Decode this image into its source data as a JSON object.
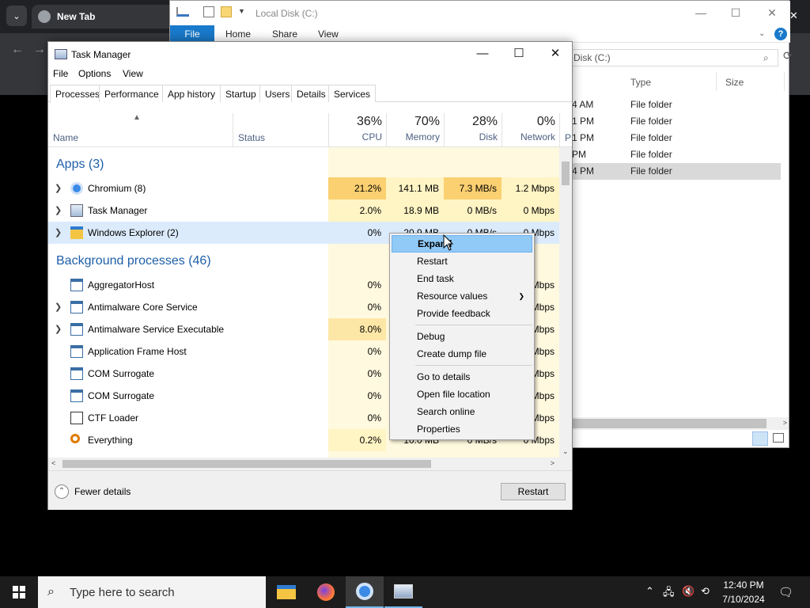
{
  "chrome": {
    "tab_title": "New Tab",
    "close_symbol": "✕"
  },
  "explorer": {
    "title": "Local Disk (C:)",
    "ribbon": [
      "File",
      "Home",
      "Share",
      "View"
    ],
    "address": "Disk (C:)",
    "columns": {
      "type": "Type",
      "size": "Size"
    },
    "rows": [
      {
        "date": "4 AM",
        "type": "File folder",
        "selected": false
      },
      {
        "date": "1 PM",
        "type": "File folder",
        "selected": false
      },
      {
        "date": "1 PM",
        "type": "File folder",
        "selected": false
      },
      {
        "date": "PM",
        "type": "File folder",
        "selected": false
      },
      {
        "date": "4 PM",
        "type": "File folder",
        "selected": true
      }
    ]
  },
  "taskmanager": {
    "title": "Task Manager",
    "menu": [
      "File",
      "Options",
      "View"
    ],
    "tabs": [
      "Processes",
      "Performance",
      "App history",
      "Startup",
      "Users",
      "Details",
      "Services"
    ],
    "active_tab": "Processes",
    "header": {
      "name": "Name",
      "status": "Status",
      "cpu_pct": "36%",
      "cpu": "CPU",
      "mem_pct": "70%",
      "mem": "Memory",
      "disk_pct": "28%",
      "disk": "Disk",
      "net_pct": "0%",
      "net": "Network",
      "power": "P"
    },
    "apps_group": "Apps (3)",
    "apps": [
      {
        "name": "Chromium (8)",
        "cpu": "21.2%",
        "mem": "141.1 MB",
        "disk": "7.3 MB/s",
        "net": "1.2 Mbps",
        "icon": "chromium-icon"
      },
      {
        "name": "Task Manager",
        "cpu": "2.0%",
        "mem": "18.9 MB",
        "disk": "0 MB/s",
        "net": "0 Mbps",
        "icon": "task-manager-icon"
      },
      {
        "name": "Windows Explorer (2)",
        "cpu": "0%",
        "mem": "20.9 MB",
        "disk": "0 MB/s",
        "net": "0 Mbps",
        "icon": "explorer-icon"
      }
    ],
    "bg_group": "Background processes (46)",
    "background": [
      {
        "name": "AggregatorHost",
        "cpu": "0%",
        "net": "Mbps",
        "expandable": false
      },
      {
        "name": "Antimalware Core Service",
        "cpu": "0%",
        "net": "Mbps",
        "expandable": true
      },
      {
        "name": "Antimalware Service Executable",
        "cpu": "8.0%",
        "net": "Mbps",
        "expandable": true
      },
      {
        "name": "Application Frame Host",
        "cpu": "0%",
        "net": "Mbps",
        "expandable": false
      },
      {
        "name": "COM Surrogate",
        "cpu": "0%",
        "net": "Mbps",
        "expandable": false
      },
      {
        "name": "COM Surrogate",
        "cpu": "0%",
        "net": "Mbps",
        "expandable": false
      },
      {
        "name": "CTF Loader",
        "cpu": "0%",
        "net": "Mbps",
        "expandable": false
      },
      {
        "name": "Everything",
        "cpu": "0.2%",
        "mem": "10.0 MB",
        "disk": "0 MB/s",
        "net": "0 Mbps",
        "expandable": false
      }
    ],
    "fewer_details": "Fewer details",
    "restart_button": "Restart"
  },
  "context_menu": {
    "items": [
      "Expand",
      "Restart",
      "End task",
      "Resource values",
      "Provide feedback",
      "Debug",
      "Create dump file",
      "Go to details",
      "Open file location",
      "Search online",
      "Properties"
    ]
  },
  "taskbar": {
    "search_placeholder": "Type here to search",
    "time": "12:40 PM",
    "date": "7/10/2024"
  },
  "colors": {
    "accent": "#1979ca",
    "heat_high": "#fbd071",
    "heat_mid": "#fde7a7",
    "heat_low": "#fff4c4",
    "group_text": "#1e5fa8"
  }
}
